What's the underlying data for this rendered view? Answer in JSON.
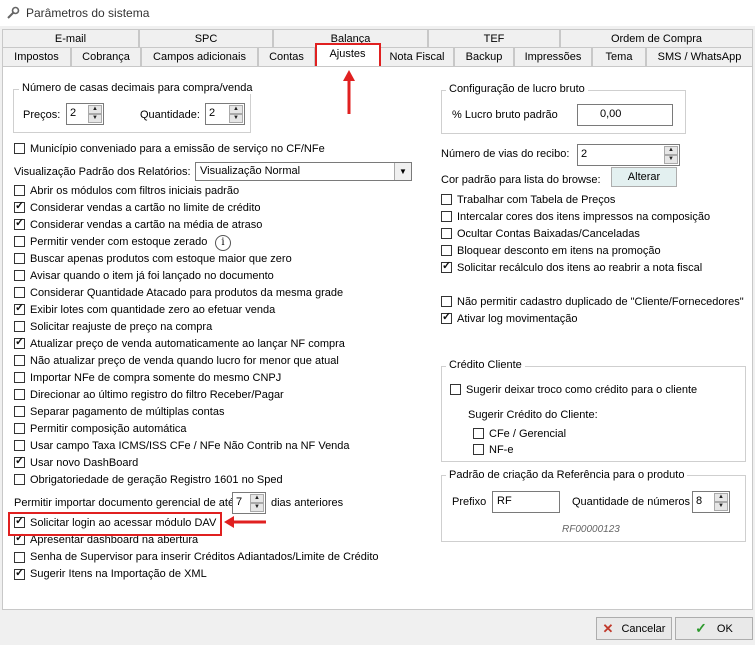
{
  "window": {
    "title": "Parâmetros do sistema"
  },
  "tabs_row1": [
    "E-mail",
    "SPC",
    "Balança",
    "TEF",
    "Ordem de Compra"
  ],
  "tabs_row2": [
    "Impostos",
    "Cobrança",
    "Campos adicionais",
    "Contas",
    "Ajustes",
    "Nota Fiscal",
    "Backup",
    "Impressões",
    "Tema",
    "SMS / WhatsApp"
  ],
  "decimals": {
    "title": "Número de casas decimais para compra/venda",
    "precos_label": "Preços:",
    "precos_value": "2",
    "quantidade_label": "Quantidade:",
    "quantidade_value": "2"
  },
  "municipio": "Município conveniado para a emissão de serviço no CF/NFe",
  "report_view": {
    "label": "Visualização Padrão dos Relatórios:",
    "value": "Visualização Normal"
  },
  "left_options": [
    {
      "label": "Abrir os módulos com filtros iniciais padrão",
      "checked": false
    },
    {
      "label": "Considerar vendas a cartão no limite de crédito",
      "checked": true
    },
    {
      "label": "Considerar vendas a cartão na média de atraso",
      "checked": true
    },
    {
      "label": "Permitir vender com estoque zerado",
      "checked": false
    },
    {
      "label": "Buscar apenas produtos com estoque maior que zero",
      "checked": false
    },
    {
      "label": "Avisar quando o item já foi lançado no documento",
      "checked": false
    },
    {
      "label": "Considerar Quantidade Atacado para produtos da mesma grade",
      "checked": false
    },
    {
      "label": "Exibir lotes com quantidade zero ao efetuar venda",
      "checked": true
    },
    {
      "label": "Solicitar reajuste de preço na compra",
      "checked": false
    },
    {
      "label": "Atualizar preço de venda automaticamente ao lançar NF compra",
      "checked": true
    },
    {
      "label": "Não atualizar preço de venda quando lucro for menor que atual",
      "checked": false
    },
    {
      "label": "Importar NFe de compra somente do mesmo CNPJ",
      "checked": false
    },
    {
      "label": "Direcionar ao último registro do filtro Receber/Pagar",
      "checked": false
    },
    {
      "label": "Separar pagamento de múltiplas contas",
      "checked": false
    },
    {
      "label": "Permitir composição automática",
      "checked": false
    },
    {
      "label": "Usar campo Taxa ICMS/ISS CFe / NFe Não Contrib na NF Venda",
      "checked": false
    },
    {
      "label": "Usar novo DashBoard",
      "checked": true
    },
    {
      "label": "Obrigatoriedade de geração Registro 1601 no Sped",
      "checked": false
    }
  ],
  "import_days": {
    "prefix": "Permitir importar documento gerencial de até",
    "value": "7",
    "suffix": "dias anteriores"
  },
  "left_options2": [
    {
      "label": "Solicitar login ao acessar módulo DAV",
      "checked": true
    },
    {
      "label": "Apresentar dashboard na abertura",
      "checked": true
    },
    {
      "label": "Senha de Supervisor para inserir Créditos Adiantados/Limite de Crédito",
      "checked": false
    },
    {
      "label": "Sugerir Itens na Importação de XML",
      "checked": true
    }
  ],
  "lucro": {
    "title": "Configuração de lucro bruto",
    "label": "% Lucro bruto padrão",
    "value": "0,00"
  },
  "vias": {
    "label": "Número de vias do recibo:",
    "value": "2"
  },
  "browse_color": {
    "label": "Cor padrão para lista do browse:",
    "button": "Alterar"
  },
  "right_options": [
    {
      "label": "Trabalhar com Tabela de Preços",
      "checked": false
    },
    {
      "label": "Intercalar cores dos itens impressos na composição",
      "checked": false
    },
    {
      "label": "Ocultar Contas Baixadas/Canceladas",
      "checked": false
    },
    {
      "label": "Bloquear desconto em itens na promoção",
      "checked": false
    },
    {
      "label": "Solicitar recálculo dos itens ao reabrir a nota fiscal",
      "checked": true
    }
  ],
  "right_options2": [
    {
      "label": "Não permitir cadastro duplicado de \"Cliente/Fornecedores\"",
      "checked": false
    },
    {
      "label": "Ativar log movimentação",
      "checked": true
    }
  ],
  "credito": {
    "title": "Crédito Cliente",
    "troco": "Sugerir deixar troco como crédito para o cliente",
    "sugerir_label": "Sugerir Crédito do Cliente:",
    "cfe": "CFe / Gerencial",
    "nfe": "NF-e"
  },
  "referencia": {
    "title": "Padrão de criação da Referência para o produto",
    "prefixo_label": "Prefixo",
    "prefixo_value": "RF",
    "qtd_label": "Quantidade de números",
    "qtd_value": "8",
    "example": "RF00000123"
  },
  "footer": {
    "cancel": "Cancelar",
    "ok": "OK"
  },
  "colors": {
    "highlight": "#e02020",
    "ok_check": "#2e9a2e",
    "cancel_x": "#c0392b"
  }
}
